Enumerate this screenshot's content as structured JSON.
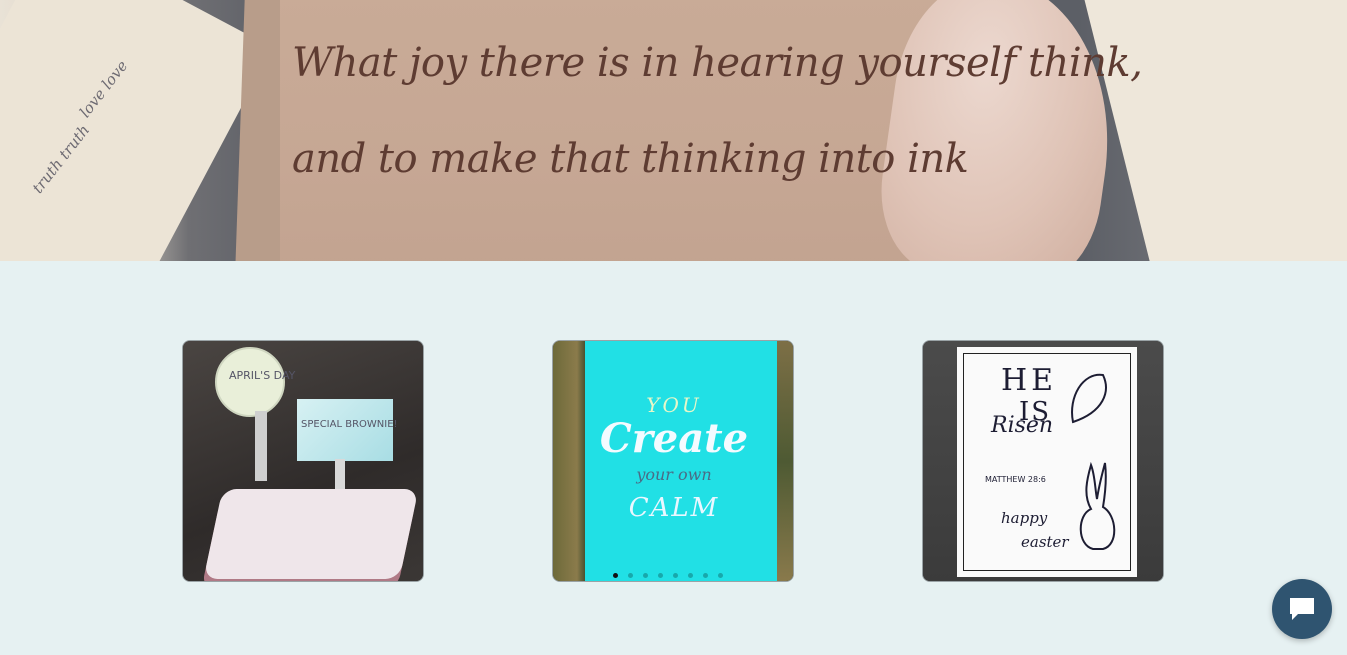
{
  "hero": {
    "quote_line1": "What joy there is in hearing yourself think,",
    "quote_line2": "and to make that thinking into ink"
  },
  "gallery": {
    "cards": [
      {
        "image_alt": "April Fools Day special brownie calligraphy display",
        "text_visible": [
          "APRIL'S DAY",
          "SPECIAL BROWNIE!"
        ]
      },
      {
        "image_alt": "You create your own calm lettering on turquoise paper",
        "text_visible": [
          "YOU",
          "Create",
          "your own",
          "CALM"
        ],
        "carousel": {
          "total": 8,
          "active_index": 0
        }
      },
      {
        "image_alt": "He is risen happy easter card",
        "text_visible": [
          "HE",
          "IS",
          "Risen",
          "MATTHEW 28:6",
          "happy",
          "easter"
        ]
      }
    ]
  },
  "chat": {
    "icon": "chat-bubble-icon"
  },
  "colors": {
    "page_bg": "#e6f1f2",
    "quote_color": "#5e3c32",
    "chat_button": "#2f5470",
    "create_card_bg": "#21e0e5"
  }
}
